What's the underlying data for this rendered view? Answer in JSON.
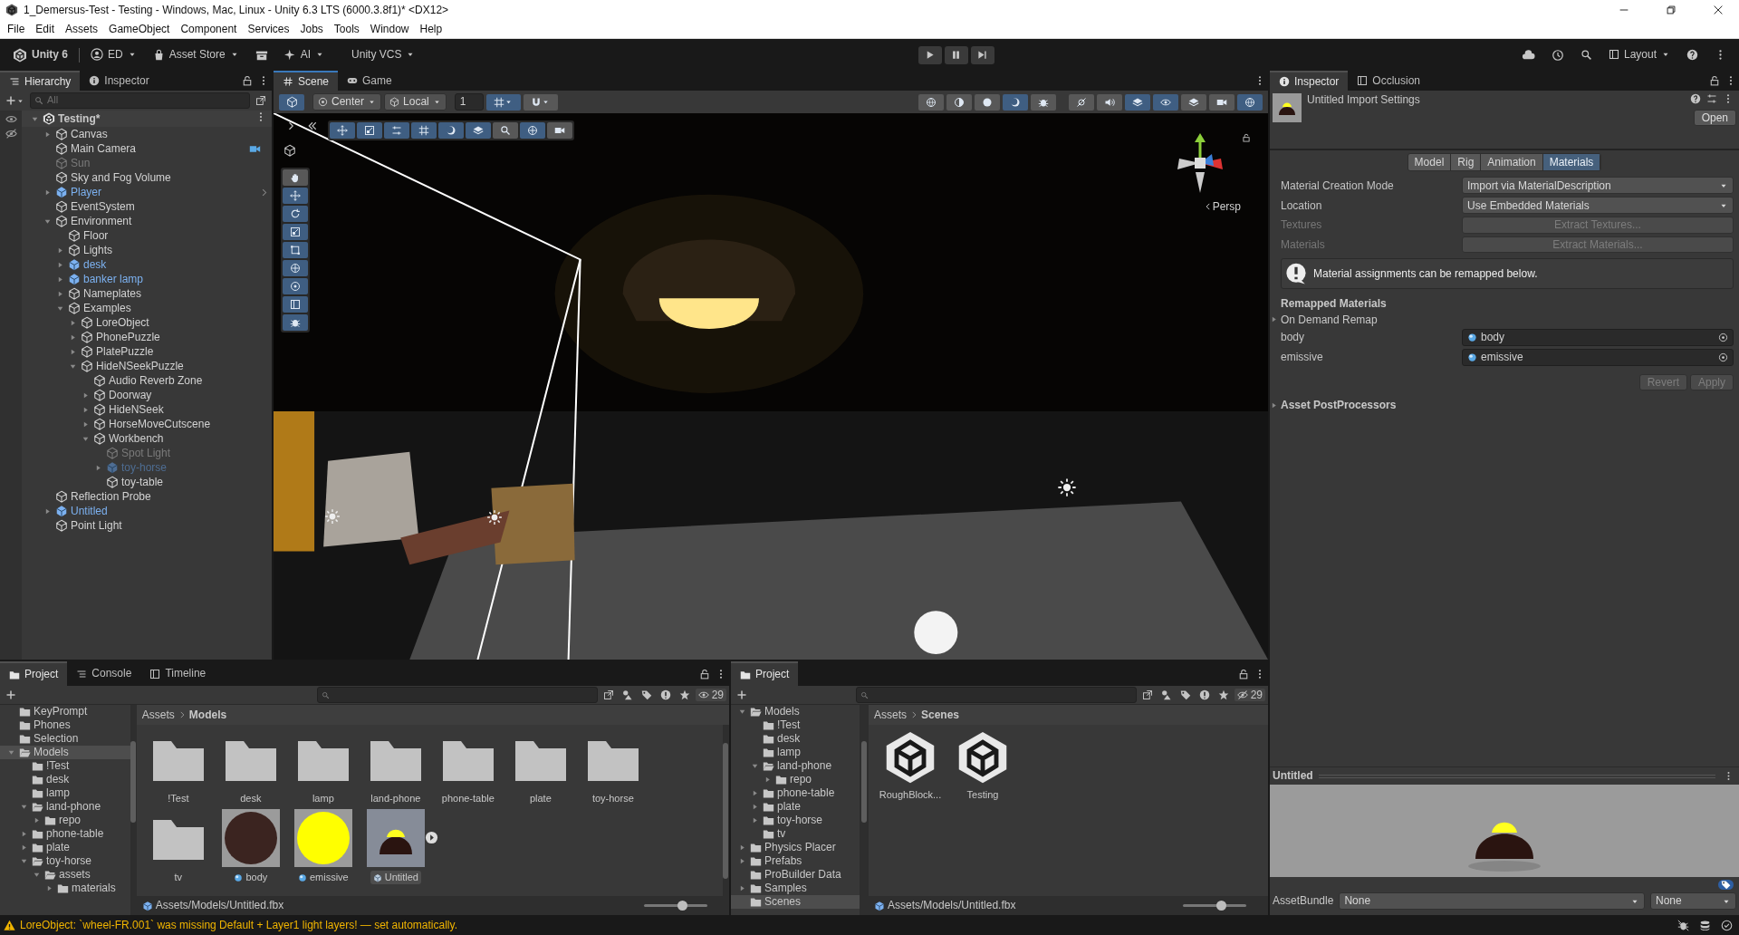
{
  "window": {
    "title": "1_Demersus-Test - Testing - Windows, Mac, Linux - Unity 6.3 LTS (6000.3.8f1)* <DX12>"
  },
  "menu": [
    "File",
    "Edit",
    "Assets",
    "GameObject",
    "Component",
    "Services",
    "Jobs",
    "Tools",
    "Window",
    "Help"
  ],
  "toolbar": {
    "product": "Unity 6",
    "account": "ED",
    "asset_store": "Asset Store",
    "ai": "AI",
    "vcs": "Unity VCS",
    "layout": "Layout"
  },
  "hierarchy": {
    "tabs": [
      {
        "label": "Hierarchy",
        "selected": true
      },
      {
        "label": "Inspector",
        "selected": false
      }
    ],
    "search_placeholder": "All",
    "scene": "Testing*",
    "items": [
      {
        "label": "Canvas",
        "kind": "object",
        "disabled": false,
        "expanded": false
      },
      {
        "label": "Main Camera",
        "kind": "object",
        "disabled": false,
        "camera_icon": true
      },
      {
        "label": "Sun",
        "kind": "object",
        "disabled": true
      },
      {
        "label": "Sky and Fog Volume",
        "kind": "object",
        "disabled": false
      },
      {
        "label": "Player",
        "kind": "prefab",
        "disabled": false,
        "expanded": false,
        "open_prefab_arrow": true
      },
      {
        "label": "EventSystem",
        "kind": "object",
        "disabled": false
      },
      {
        "label": "Environment",
        "kind": "object",
        "disabled": false,
        "expanded": true,
        "children": [
          {
            "label": "Floor",
            "kind": "object",
            "disabled": false
          },
          {
            "label": "Lights",
            "kind": "object",
            "disabled": false,
            "expanded": false
          },
          {
            "label": "desk",
            "kind": "prefab",
            "disabled": false,
            "expanded": false
          },
          {
            "label": "banker lamp",
            "kind": "prefab",
            "disabled": false,
            "expanded": false
          },
          {
            "label": "Nameplates",
            "kind": "object",
            "disabled": false,
            "expanded": false
          },
          {
            "label": "Examples",
            "kind": "object",
            "disabled": false,
            "expanded": true,
            "children": [
              {
                "label": "LoreObject",
                "kind": "object",
                "disabled": false,
                "expanded": false
              },
              {
                "label": "PhonePuzzle",
                "kind": "object",
                "disabled": false,
                "expanded": false
              },
              {
                "label": "PlatePuzzle",
                "kind": "object",
                "disabled": false,
                "expanded": false
              },
              {
                "label": "HideNSeekPuzzle",
                "kind": "object",
                "disabled": false,
                "expanded": true,
                "children": [
                  {
                    "label": "Audio Reverb Zone",
                    "kind": "object",
                    "disabled": false
                  },
                  {
                    "label": "Doorway",
                    "kind": "object",
                    "disabled": false,
                    "expanded": false
                  },
                  {
                    "label": "HideNSeek",
                    "kind": "object",
                    "disabled": false,
                    "expanded": false
                  },
                  {
                    "label": "HorseMoveCutscene",
                    "kind": "object",
                    "disabled": false,
                    "expanded": false
                  },
                  {
                    "label": "Workbench",
                    "kind": "object",
                    "disabled": false,
                    "expanded": true,
                    "children": [
                      {
                        "label": "Spot Light",
                        "kind": "object",
                        "disabled": true
                      },
                      {
                        "label": "toy-horse",
                        "kind": "prefab",
                        "disabled": true,
                        "expanded": false
                      },
                      {
                        "label": "toy-table",
                        "kind": "object",
                        "disabled": false
                      }
                    ]
                  }
                ]
              }
            ]
          }
        ]
      },
      {
        "label": "Reflection Probe",
        "kind": "object",
        "disabled": false
      },
      {
        "label": "Untitled",
        "kind": "prefab",
        "disabled": false,
        "expanded": false
      },
      {
        "label": "Point Light",
        "kind": "object",
        "disabled": false
      }
    ]
  },
  "scene": {
    "tabs": [
      {
        "label": "Scene",
        "selected": true
      },
      {
        "label": "Game",
        "selected": false
      }
    ],
    "pivot": "Center",
    "space": "Local",
    "grid_size": "1",
    "view_label": "Persp"
  },
  "inspector": {
    "tabs": [
      {
        "label": "Inspector",
        "selected": true
      },
      {
        "label": "Occlusion",
        "selected": false
      }
    ],
    "title": "Untitled Import Settings",
    "open_button": "Open",
    "subtabs": [
      {
        "label": "Model",
        "selected": false
      },
      {
        "label": "Rig",
        "selected": false
      },
      {
        "label": "Animation",
        "selected": false
      },
      {
        "label": "Materials",
        "selected": true
      }
    ],
    "fields": [
      {
        "label": "Material Creation Mode",
        "kind": "dropdown",
        "value": "Import via MaterialDescription",
        "disabled": false
      },
      {
        "label": "Location",
        "kind": "dropdown",
        "value": "Use Embedded Materials",
        "disabled": false
      },
      {
        "label": "Textures",
        "kind": "button",
        "value": "Extract Textures...",
        "disabled": true
      },
      {
        "label": "Materials",
        "kind": "button",
        "value": "Extract Materials...",
        "disabled": true
      }
    ],
    "help_box": "Material assignments can be remapped below.",
    "remapped_title": "Remapped Materials",
    "foldout": {
      "label": "On Demand Remap",
      "expanded": false
    },
    "remaps": [
      {
        "label": "body",
        "value": "body"
      },
      {
        "label": "emissive",
        "value": "emissive"
      }
    ],
    "actions": [
      {
        "label": "Revert",
        "disabled": true
      },
      {
        "label": "Apply",
        "disabled": true
      }
    ],
    "post_processors": {
      "label": "Asset PostProcessors",
      "expanded": false
    },
    "preview_title": "Untitled",
    "asset_bundle": {
      "label": "AssetBundle",
      "name": "None",
      "variant": "None"
    }
  },
  "projects": [
    {
      "tabs": [
        {
          "label": "Project",
          "selected": true,
          "kind": "project"
        },
        {
          "label": "Console",
          "selected": false,
          "kind": "console"
        },
        {
          "label": "Timeline",
          "selected": false,
          "kind": "timeline"
        }
      ],
      "hidden_count": "29",
      "hidden_filter": false,
      "tree": [
        {
          "label": "KeyPrompt",
          "selected": false
        },
        {
          "label": "Phones",
          "selected": false
        },
        {
          "label": "Selection",
          "selected": false
        },
        {
          "label": "Models",
          "selected": true,
          "expanded": true,
          "children": [
            {
              "label": "!Test",
              "selected": false
            },
            {
              "label": "desk",
              "selected": false
            },
            {
              "label": "lamp",
              "selected": false
            },
            {
              "label": "land-phone",
              "selected": false,
              "expanded": true,
              "children": [
                {
                  "label": "repo",
                  "selected": false,
                  "expanded": false
                }
              ]
            },
            {
              "label": "phone-table",
              "selected": false,
              "expanded": false
            },
            {
              "label": "plate",
              "selected": false,
              "expanded": false
            },
            {
              "label": "toy-horse",
              "selected": false,
              "expanded": true,
              "children": [
                {
                  "label": "assets",
                  "selected": false,
                  "expanded": true,
                  "children": [
                    {
                      "label": "materials",
                      "selected": false,
                      "expanded": false
                    }
                  ]
                }
              ]
            }
          ]
        }
      ],
      "breadcrumb": [
        "Assets",
        "Models"
      ],
      "items": [
        {
          "label": "!Test",
          "kind": "folder",
          "selected": false
        },
        {
          "label": "desk",
          "kind": "folder",
          "selected": false
        },
        {
          "label": "lamp",
          "kind": "folder",
          "selected": false
        },
        {
          "label": "land-phone",
          "kind": "folder",
          "selected": false
        },
        {
          "label": "phone-table",
          "kind": "folder",
          "selected": false
        },
        {
          "label": "plate",
          "kind": "folder",
          "selected": false
        },
        {
          "label": "toy-horse",
          "kind": "folder",
          "selected": false
        },
        {
          "label": "tv",
          "kind": "folder",
          "selected": false
        },
        {
          "label": "body",
          "kind": "material",
          "selected": false,
          "color": "#3b2420"
        },
        {
          "label": "emissive",
          "kind": "material",
          "selected": false,
          "color": "#ffff00"
        },
        {
          "label": "Untitled",
          "kind": "model",
          "selected": true
        }
      ],
      "path": "Assets/Models/Untitled.fbx",
      "zoom": {
        "level": 0.6
      }
    },
    {
      "tabs": [
        {
          "label": "Project",
          "selected": true,
          "kind": "project"
        }
      ],
      "hidden_count": "29",
      "hidden_filter": true,
      "tree": [
        {
          "label": "Models",
          "selected": false,
          "expanded": true,
          "children": [
            {
              "label": "!Test",
              "selected": false
            },
            {
              "label": "desk",
              "selected": false
            },
            {
              "label": "lamp",
              "selected": false
            },
            {
              "label": "land-phone",
              "selected": false,
              "expanded": true,
              "children": [
                {
                  "label": "repo",
                  "selected": false,
                  "expanded": false
                }
              ]
            },
            {
              "label": "phone-table",
              "selected": false,
              "expanded": false
            },
            {
              "label": "plate",
              "selected": false,
              "expanded": false
            },
            {
              "label": "toy-horse",
              "selected": false,
              "expanded": false
            },
            {
              "label": "tv",
              "selected": false
            }
          ]
        },
        {
          "label": "Physics Placer",
          "selected": false,
          "expanded": false
        },
        {
          "label": "Prefabs",
          "selected": false,
          "expanded": false
        },
        {
          "label": "ProBuilder Data",
          "selected": false
        },
        {
          "label": "Samples",
          "selected": false,
          "expanded": false
        },
        {
          "label": "Scenes",
          "selected": true
        }
      ],
      "breadcrumb": [
        "Assets",
        "Scenes"
      ],
      "items": [
        {
          "label": "RoughBlock...",
          "kind": "scene",
          "selected": false
        },
        {
          "label": "Testing",
          "kind": "scene",
          "selected": false
        }
      ],
      "path": "Assets/Models/Untitled.fbx",
      "zoom": {
        "level": 0.6
      }
    }
  ],
  "status": {
    "kind": "warning",
    "message": "LoreObject: `wheel-FR.001` was missing Default + Layer1 light layers! — set automatically."
  }
}
